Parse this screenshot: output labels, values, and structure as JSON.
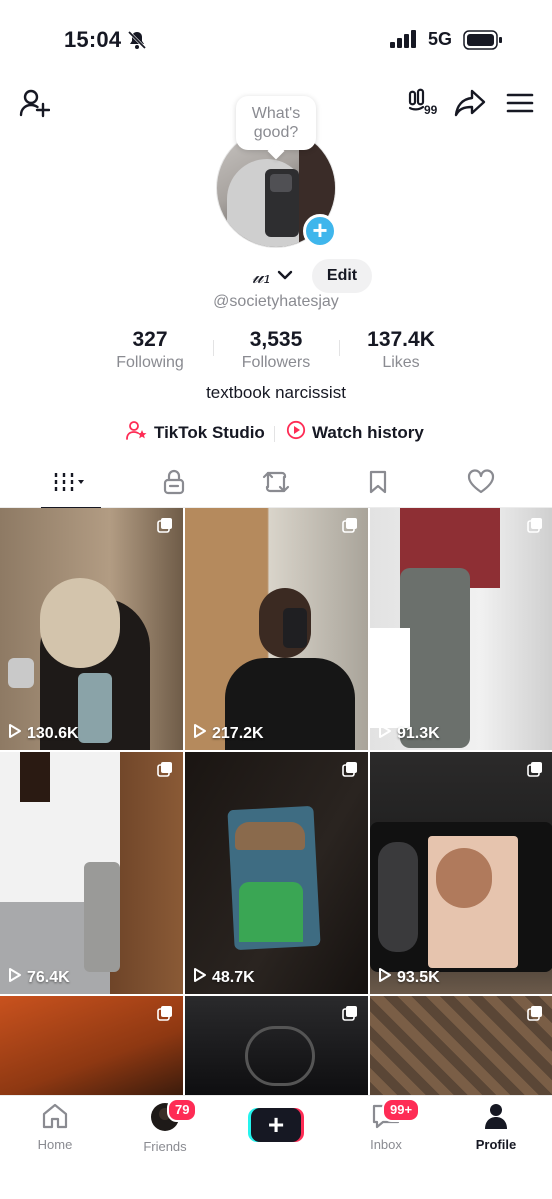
{
  "status_bar": {
    "time": "15:04",
    "network": "5G"
  },
  "profile": {
    "bubble_text": "What's good?",
    "display_name": "𝓊₁",
    "edit_label": "Edit",
    "handle": "@societyhatesjay",
    "bio": "textbook narcissist",
    "pay_badge": "99",
    "stats": [
      {
        "value": "327",
        "label": "Following"
      },
      {
        "value": "3,535",
        "label": "Followers"
      },
      {
        "value": "137.4K",
        "label": "Likes"
      }
    ]
  },
  "links": {
    "studio": "TikTok Studio",
    "history": "Watch history"
  },
  "tabs": [
    "videos",
    "private",
    "reposts",
    "favorites",
    "liked"
  ],
  "videos": [
    {
      "views": "130.6K"
    },
    {
      "views": "217.2K"
    },
    {
      "views": "91.3K"
    },
    {
      "views": "76.4K"
    },
    {
      "views": "48.7K"
    },
    {
      "views": "93.5K"
    },
    {
      "views": ""
    },
    {
      "views": ""
    },
    {
      "views": ""
    }
  ],
  "bottom_nav": {
    "home": "Home",
    "friends": "Friends",
    "friends_badge": "79",
    "inbox": "Inbox",
    "inbox_badge": "99+",
    "profile": "Profile"
  },
  "colors": {
    "accent_red": "#fe2c55",
    "accent_cyan": "#25f4ee",
    "avatar_plus": "#3fb6ec",
    "text_primary": "#161823",
    "text_secondary": "#8a8b91"
  }
}
